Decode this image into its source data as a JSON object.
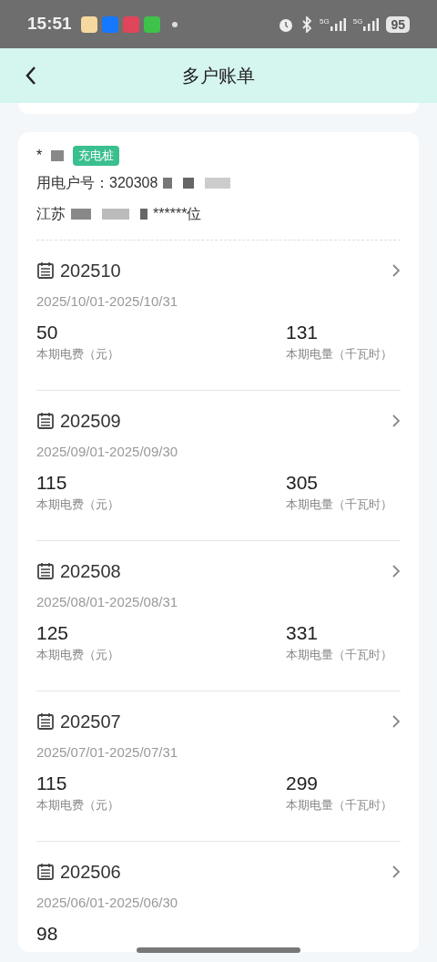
{
  "status_bar": {
    "time": "15:51",
    "network_1": "5G",
    "network_2": "5G",
    "battery": "95"
  },
  "header": {
    "title": "多户账单"
  },
  "account": {
    "name": "*",
    "tag": "充电桩",
    "account_no": "用电户号：320308",
    "address_start": "江苏",
    "address_end": "******位"
  },
  "bills": [
    {
      "month": "202510",
      "period": "2025/10/01-2025/10/31",
      "fee": "50",
      "fee_label": "本期电费（元）",
      "usage": "131",
      "usage_label": "本期电量（千瓦时）"
    },
    {
      "month": "202509",
      "period": "2025/09/01-2025/09/30",
      "fee": "115",
      "fee_label": "本期电费（元）",
      "usage": "305",
      "usage_label": "本期电量（千瓦时）"
    },
    {
      "month": "202508",
      "period": "2025/08/01-2025/08/31",
      "fee": "125",
      "fee_label": "本期电费（元）",
      "usage": "331",
      "usage_label": "本期电量（千瓦时）"
    },
    {
      "month": "202507",
      "period": "2025/07/01-2025/07/31",
      "fee": "115",
      "fee_label": "本期电费（元）",
      "usage": "299",
      "usage_label": "本期电量（千瓦时）"
    },
    {
      "month": "202506",
      "period": "2025/06/01-2025/06/30",
      "fee": "98"
    }
  ]
}
